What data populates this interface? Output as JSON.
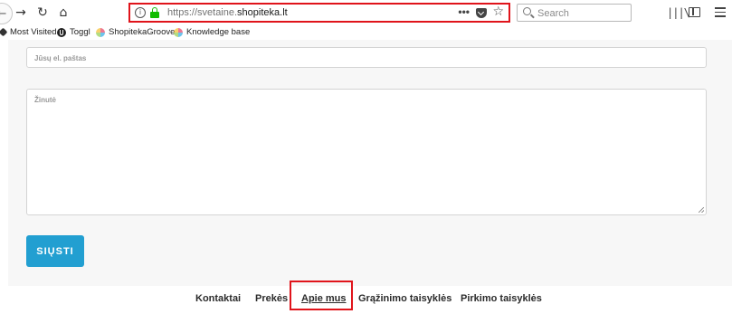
{
  "browser": {
    "url_prefix": "https://svetaine.",
    "url_domain": "shopiteka.lt",
    "more_label": "•••",
    "search_placeholder": "Search",
    "highlight_color": "#e0141b"
  },
  "bookmarks": [
    {
      "label": "Most Visited",
      "icon": "gear-icon"
    },
    {
      "label": "Toggl",
      "icon": "toggl-icon"
    },
    {
      "label": "ShopitekaGroove",
      "icon": "favicon-icon"
    },
    {
      "label": "Knowledge base",
      "icon": "favicon-icon"
    }
  ],
  "form": {
    "email_placeholder": "Jūsų el. paštas",
    "message_placeholder": "Žinutė",
    "send_label": "SIŲSTI",
    "send_color": "#229fd1"
  },
  "footer": {
    "links": [
      "Kontaktai",
      "Prekės",
      "Apie mus",
      "Grąžinimo taisyklės",
      "Pirkimo taisyklės"
    ],
    "active": "Apie mus"
  }
}
